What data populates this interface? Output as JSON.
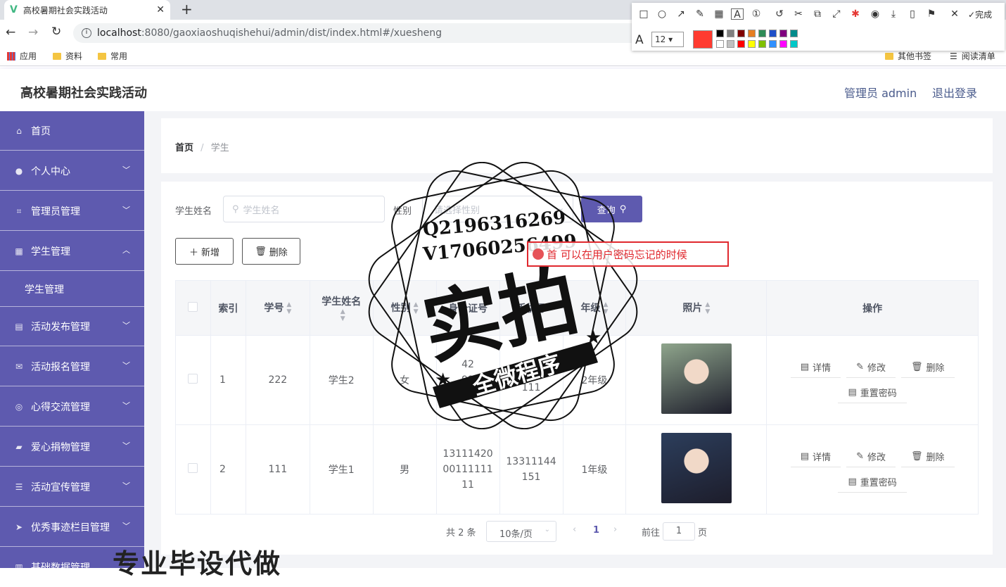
{
  "browser": {
    "tab_title": "高校暑期社会实践活动",
    "url_host": "localhost",
    "url_rest": ":8080/gaoxiaoshuqishehui/admin/dist/index.html#/xuesheng",
    "bookmarks": [
      "应用",
      "资料",
      "常用"
    ],
    "bookmarks_right": [
      "其他书签",
      "阅读清单"
    ]
  },
  "annotation_toolbar": {
    "done_label": "完成",
    "font_size": "12",
    "selected_color": "#ff3b30",
    "palette": [
      "#000000",
      "#808080",
      "#800000",
      "#e67e22",
      "#2e8b57",
      "#1e50c8",
      "#800080",
      "#008b8b",
      "#ffffff",
      "#c0c0c0",
      "#ff0000",
      "#ffff00",
      "#80c000",
      "#3090ff",
      "#ff00ff",
      "#00c8c8"
    ]
  },
  "header": {
    "app_title": "高校暑期社会实践活动",
    "admin_label": "管理员 admin",
    "logout_label": "退出登录"
  },
  "sidebar": {
    "items": [
      {
        "label": "首页",
        "icon": "home-icon",
        "expandable": false
      },
      {
        "label": "个人中心",
        "icon": "user-icon",
        "expandable": true
      },
      {
        "label": "管理员管理",
        "icon": "crop-icon",
        "expandable": true
      },
      {
        "label": "学生管理",
        "icon": "grid-icon",
        "expandable": true,
        "expanded": true
      },
      {
        "label": "活动发布管理",
        "icon": "chart-icon",
        "expandable": true
      },
      {
        "label": "活动报名管理",
        "icon": "mail-icon",
        "expandable": true
      },
      {
        "label": "心得交流管理",
        "icon": "compass-icon",
        "expandable": true
      },
      {
        "label": "爱心捐物管理",
        "icon": "ticket-icon",
        "expandable": true
      },
      {
        "label": "活动宣传管理",
        "icon": "sliders-icon",
        "expandable": true
      },
      {
        "label": "优秀事迹栏目管理",
        "icon": "send-icon",
        "expandable": true
      },
      {
        "label": "基础数据管理",
        "icon": "data-icon",
        "expandable": true
      }
    ],
    "submenu": "学生管理"
  },
  "breadcrumb": {
    "home": "首页",
    "separator": "/",
    "current": "学生"
  },
  "search": {
    "name_label": "学生姓名",
    "name_placeholder": "学生姓名",
    "gender_label": "性别",
    "gender_placeholder": "请选择性别",
    "query_label": "查询"
  },
  "actions": {
    "add_label": "新增",
    "delete_label": "删除"
  },
  "table": {
    "columns": [
      "索引",
      "学号",
      "学生姓名",
      "性别",
      "身份证号",
      "手机号",
      "年级",
      "照片",
      "操作"
    ],
    "rows": [
      {
        "index": "1",
        "xuehao": "222",
        "name": "学生2",
        "gender": "女",
        "idcard": "42\n91\n11",
        "phone": "224\n111",
        "grade": "2年级",
        "photo_color": "#8fa58c"
      },
      {
        "index": "2",
        "xuehao": "111",
        "name": "学生1",
        "gender": "男",
        "idcard": "13111420\n00111111\n11",
        "phone": "13311144\n151",
        "grade": "1年级",
        "photo_color": "#2c3e5c"
      }
    ],
    "ops": {
      "detail": "详情",
      "edit": "修改",
      "delete": "删除",
      "reset": "重置密码"
    }
  },
  "pagination": {
    "total": "共 2 条",
    "page_size": "10条/页",
    "current_page": "1",
    "goto_label": "前往",
    "goto_value": "1",
    "page_suffix": "页"
  },
  "watermark": {
    "qq": "Q2196316269",
    "wx": "V17060256499",
    "big": "实拍",
    "ribbon": "全微程序",
    "annotation_text": "首 可以在用户密码忘记的时候",
    "bottom": "专业毕设代做"
  }
}
